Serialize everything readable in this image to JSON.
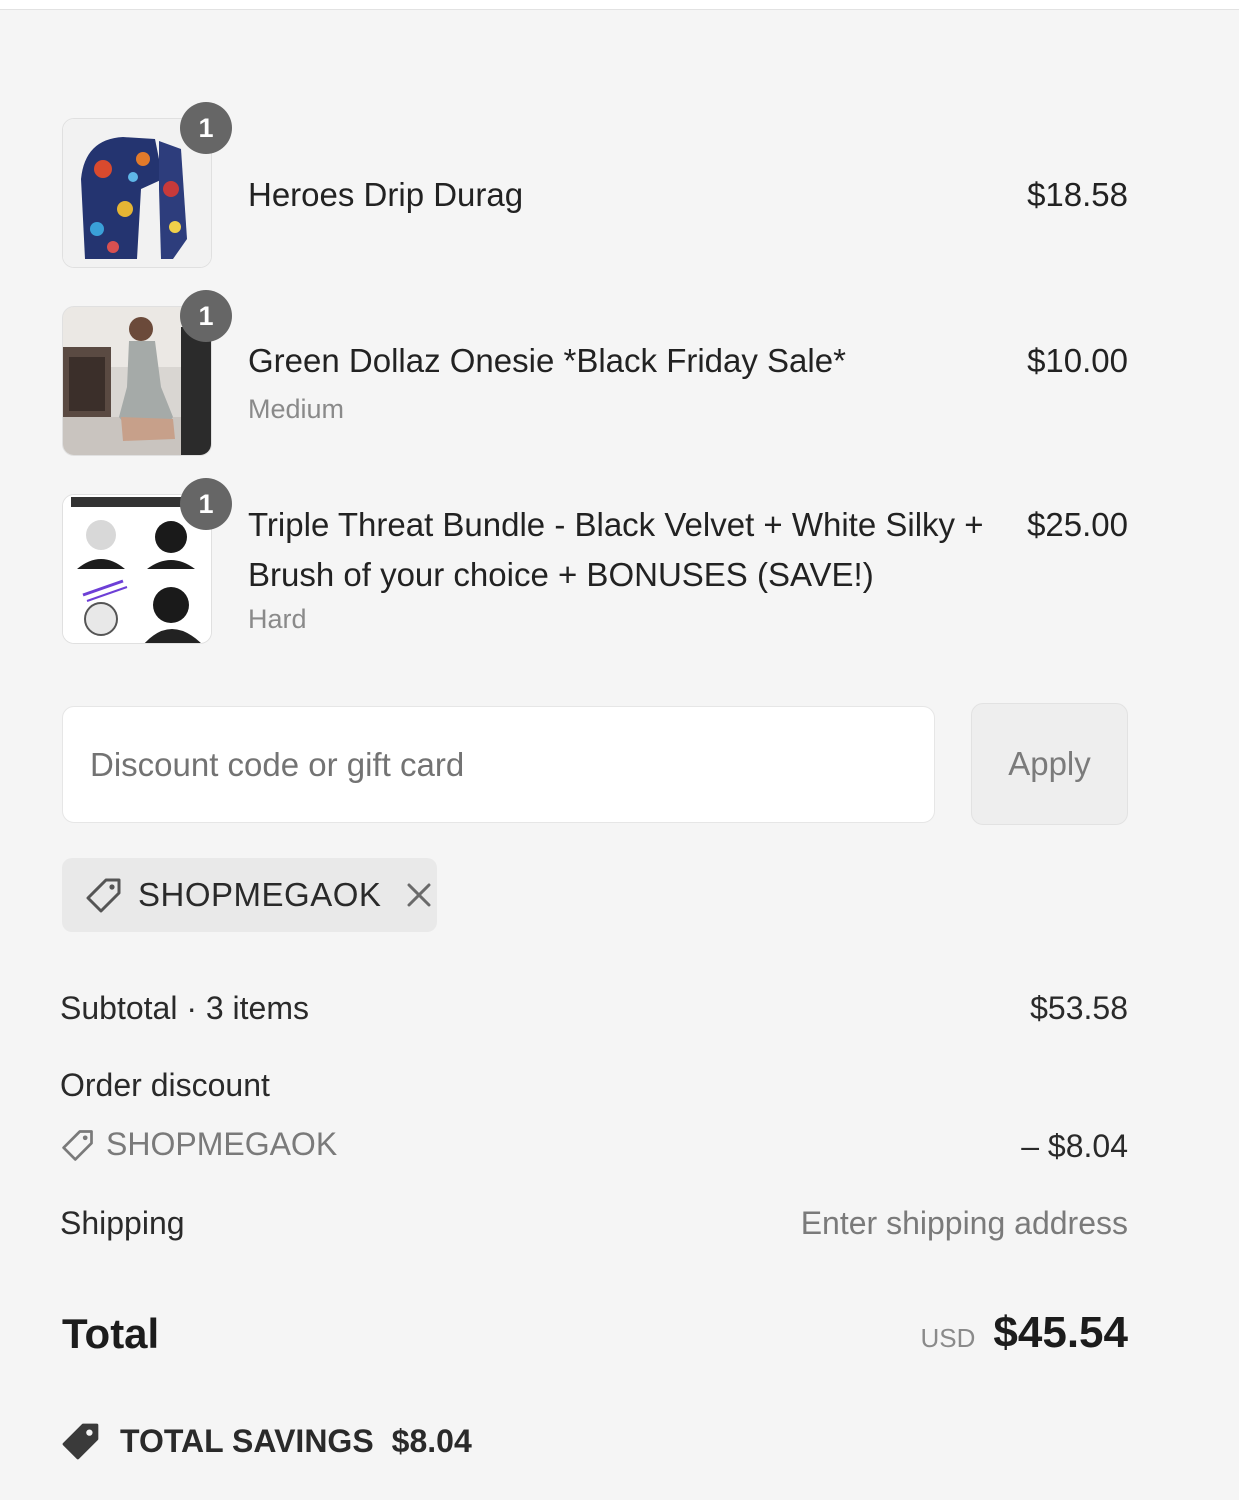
{
  "line_items": [
    {
      "name": "Heroes Drip Durag",
      "variant": "",
      "price": "$18.58",
      "quantity": "1",
      "thumbnail": "durag-photo"
    },
    {
      "name": "Green Dollaz Onesie *Black Friday Sale*",
      "variant": "Medium",
      "price": "$10.00",
      "quantity": "1",
      "thumbnail": "onesie-photo"
    },
    {
      "name": "Triple Threat Bundle - Black Velvet + White Silky + Brush of your choice + BONUSES (SAVE!)",
      "variant": "Hard",
      "price": "$25.00",
      "quantity": "1",
      "thumbnail": "bundle-collage-photo"
    }
  ],
  "discount": {
    "placeholder": "Discount code or gift card",
    "value": "",
    "apply_label": "Apply",
    "applied_code": "SHOPMEGAOK"
  },
  "summary": {
    "subtotal_label": "Subtotal · 3 items",
    "subtotal_value": "$53.58",
    "order_discount_label": "Order discount",
    "order_discount_code": "SHOPMEGAOK",
    "order_discount_value": "– $8.04",
    "shipping_label": "Shipping",
    "shipping_value": "Enter shipping address",
    "total_label": "Total",
    "currency": "USD",
    "total_value": "$45.54",
    "savings_label": "TOTAL SAVINGS",
    "savings_value": "$8.04"
  },
  "icons": {
    "tag": "tag-icon",
    "remove": "close-icon"
  },
  "colors": {
    "background": "#f5f5f5",
    "badge": "#666666",
    "muted_text": "#7a7a7a"
  }
}
